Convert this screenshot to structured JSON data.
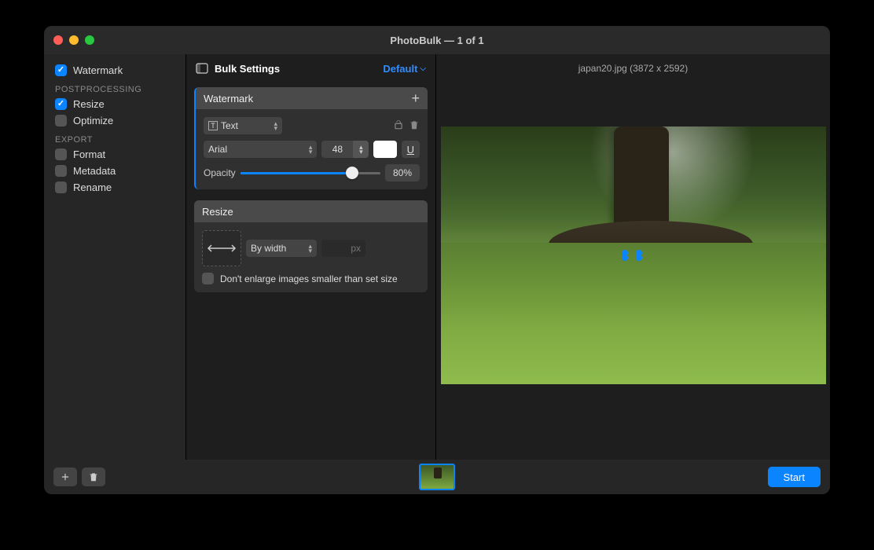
{
  "window": {
    "title": "PhotoBulk — 1 of 1"
  },
  "sidebar": {
    "watermark": "Watermark",
    "headers": {
      "post": "POSTPROCESSING",
      "export": "EXPORT"
    },
    "resize": "Resize",
    "optimize": "Optimize",
    "format": "Format",
    "metadata": "Metadata",
    "rename": "Rename"
  },
  "settings": {
    "title": "Bulk Settings",
    "preset": "Default"
  },
  "watermark": {
    "title": "Watermark",
    "type": "Text",
    "font": "Arial",
    "size": "48",
    "underline": "U",
    "opacity_label": "Opacity",
    "opacity_value": "80%"
  },
  "resize": {
    "title": "Resize",
    "mode": "By width",
    "unit": "px",
    "dont_enlarge": "Don't enlarge images smaller than set size"
  },
  "preview": {
    "filename": "japan20.jpg (3872 x 2592)"
  },
  "bottom": {
    "start": "Start"
  }
}
